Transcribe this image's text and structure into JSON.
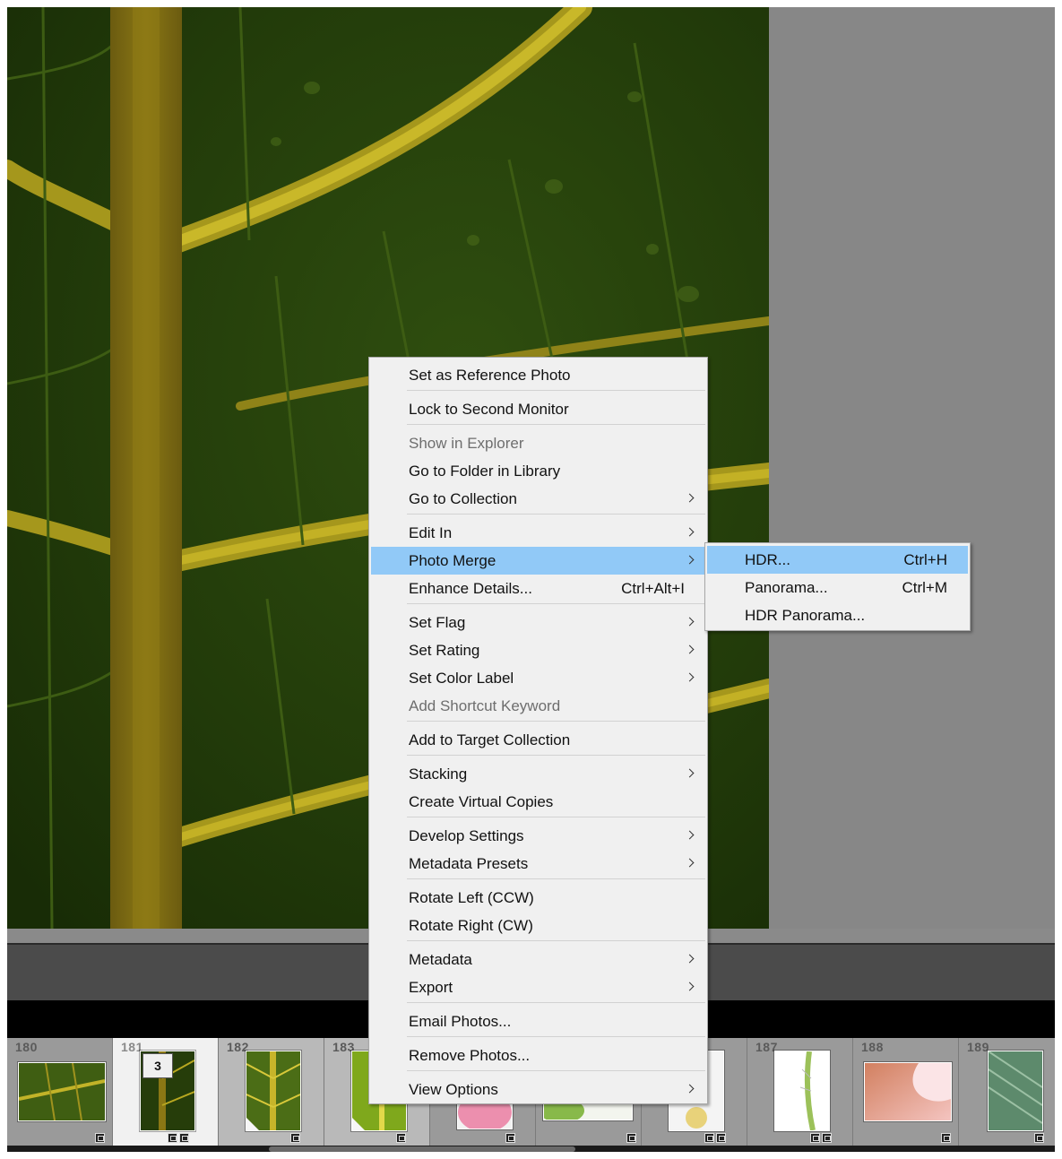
{
  "context_menu": {
    "items": [
      {
        "label": "Set as Reference Photo",
        "shortcut": "",
        "submenu": false,
        "disabled": false
      },
      {
        "label": "Lock to Second Monitor",
        "shortcut": "",
        "submenu": false,
        "disabled": false
      },
      {
        "label": "Show in Explorer",
        "shortcut": "",
        "submenu": false,
        "disabled": true
      },
      {
        "label": "Go to Folder in Library",
        "shortcut": "",
        "submenu": false,
        "disabled": false
      },
      {
        "label": "Go to Collection",
        "shortcut": "",
        "submenu": true,
        "disabled": false
      },
      {
        "label": "Edit In",
        "shortcut": "",
        "submenu": true,
        "disabled": false
      },
      {
        "label": "Photo Merge",
        "shortcut": "",
        "submenu": true,
        "disabled": false,
        "highlighted": true
      },
      {
        "label": "Enhance Details...",
        "shortcut": "Ctrl+Alt+I",
        "submenu": false,
        "disabled": false
      },
      {
        "label": "Set Flag",
        "shortcut": "",
        "submenu": true,
        "disabled": false
      },
      {
        "label": "Set Rating",
        "shortcut": "",
        "submenu": true,
        "disabled": false
      },
      {
        "label": "Set Color Label",
        "shortcut": "",
        "submenu": true,
        "disabled": false
      },
      {
        "label": "Add Shortcut Keyword",
        "shortcut": "",
        "submenu": false,
        "disabled": true
      },
      {
        "label": "Add to Target Collection",
        "shortcut": "",
        "submenu": false,
        "disabled": false
      },
      {
        "label": "Stacking",
        "shortcut": "",
        "submenu": true,
        "disabled": false
      },
      {
        "label": "Create Virtual Copies",
        "shortcut": "",
        "submenu": false,
        "disabled": false
      },
      {
        "label": "Develop Settings",
        "shortcut": "",
        "submenu": true,
        "disabled": false
      },
      {
        "label": "Metadata Presets",
        "shortcut": "",
        "submenu": true,
        "disabled": false
      },
      {
        "label": "Rotate Left (CCW)",
        "shortcut": "",
        "submenu": false,
        "disabled": false
      },
      {
        "label": "Rotate Right (CW)",
        "shortcut": "",
        "submenu": false,
        "disabled": false
      },
      {
        "label": "Metadata",
        "shortcut": "",
        "submenu": true,
        "disabled": false
      },
      {
        "label": "Export",
        "shortcut": "",
        "submenu": true,
        "disabled": false
      },
      {
        "label": "Email Photos...",
        "shortcut": "",
        "submenu": false,
        "disabled": false
      },
      {
        "label": "Remove Photos...",
        "shortcut": "",
        "submenu": false,
        "disabled": false
      },
      {
        "label": "View Options",
        "shortcut": "",
        "submenu": true,
        "disabled": false
      }
    ]
  },
  "submenu": {
    "parent": "Photo Merge",
    "items": [
      {
        "label": "HDR...",
        "shortcut": "Ctrl+H",
        "highlighted": true
      },
      {
        "label": "Panorama...",
        "shortcut": "Ctrl+M",
        "highlighted": false
      },
      {
        "label": "HDR Panorama...",
        "shortcut": "",
        "highlighted": false
      }
    ]
  },
  "filmstrip": {
    "cells": [
      {
        "number": "180",
        "stack_count": "",
        "state": "normal",
        "thumb": "leaf-green"
      },
      {
        "number": "181",
        "stack_count": "3",
        "state": "active",
        "thumb": "leaf-dark"
      },
      {
        "number": "182",
        "stack_count": "",
        "state": "selected",
        "thumb": "leaf-bright"
      },
      {
        "number": "183",
        "stack_count": "",
        "state": "selected",
        "thumb": "leaf-lime"
      },
      {
        "number": "",
        "stack_count": "",
        "state": "normal",
        "thumb": "pink-flower"
      },
      {
        "number": "",
        "stack_count": "",
        "state": "normal",
        "thumb": "white-green"
      },
      {
        "number": "",
        "stack_count": "",
        "state": "normal",
        "thumb": "white-flower"
      },
      {
        "number": "187",
        "stack_count": "",
        "state": "normal",
        "thumb": "cactus-white"
      },
      {
        "number": "188",
        "stack_count": "",
        "state": "normal",
        "thumb": "pink-petal"
      },
      {
        "number": "189",
        "stack_count": "",
        "state": "normal",
        "thumb": "leaf-teal"
      }
    ]
  },
  "colors": {
    "highlight": "#91c9f7",
    "menu_bg": "#f0f0f0",
    "app_bg": "#878787"
  }
}
